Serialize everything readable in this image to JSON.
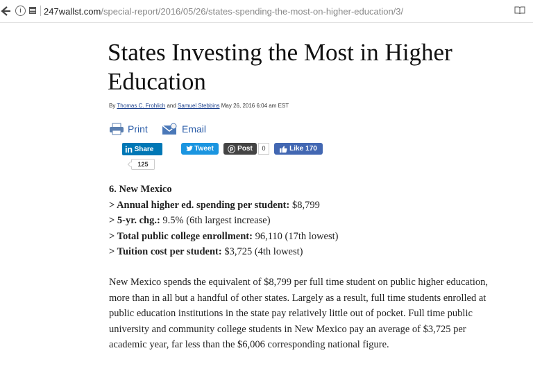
{
  "browser": {
    "url_host": "247wallst.com",
    "url_path": "/special-report/2016/05/26/states-spending-the-most-on-higher-education/3/"
  },
  "article": {
    "title": "States Investing the Most in Higher Education",
    "byline_prefix": "By",
    "author1": "Thomas C. Frohlich",
    "and": "and",
    "author2": "Samuel Stebbins",
    "date": "May 26, 2016 6:04 am EST"
  },
  "actions": {
    "print": "Print",
    "email": "Email"
  },
  "social": {
    "linkedin_label": "Share",
    "linkedin_count": "125",
    "tweet_label": "Tweet",
    "post_label": "Post",
    "post_count": "0",
    "like_label": "Like",
    "like_count": "170"
  },
  "stats": {
    "heading": "6. New Mexico",
    "rows": [
      {
        "label": "> Annual higher ed. spending per student:",
        "value": " $8,799"
      },
      {
        "label": "> 5-yr. chg.:",
        "value": " 9.5% (6th largest increase)"
      },
      {
        "label": "> Total public college enrollment:",
        "value": " 96,110 (17th lowest)"
      },
      {
        "label": "> Tuition cost per student:",
        "value": " $3,725 (4th lowest)"
      }
    ]
  },
  "paragraph": "New Mexico spends the equivalent of $8,799 per full time student on public higher education, more than in all but a handful of other states. Largely as a result, full time students enrolled at public education institutions in the state pay relatively little out of pocket. Full time public university and community college students in New Mexico pay an average of $3,725 per academic year, far less than the $6,006 corresponding national figure.",
  "colors": {
    "link": "#2a5ca8",
    "linkedin": "#0077b5",
    "twitter": "#1b95e0",
    "facebook": "#4267b2"
  }
}
